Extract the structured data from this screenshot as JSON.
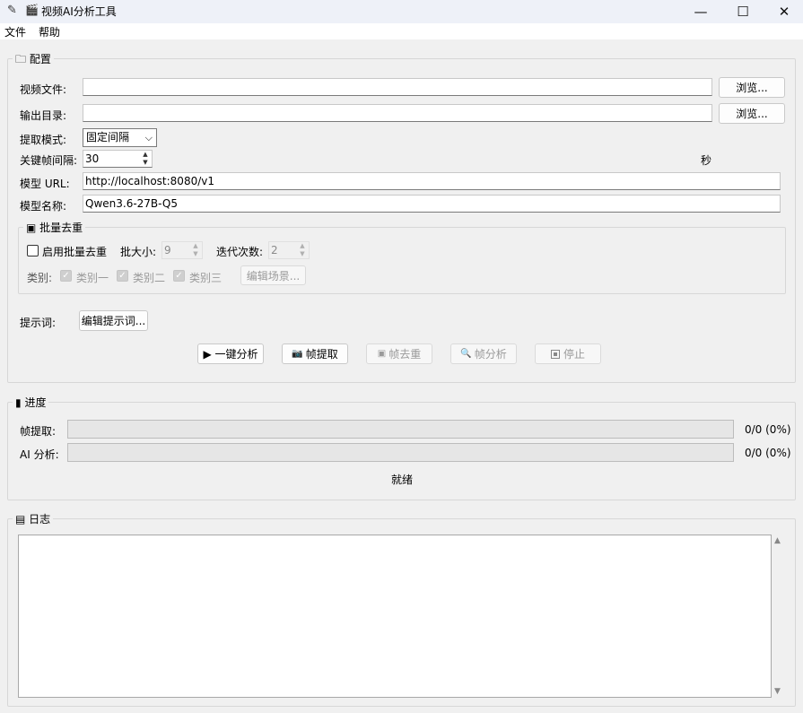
{
  "window": {
    "title": "视频AI分析工具",
    "title_icon": "clapper-icon",
    "minimize": "—",
    "maximize": "☐",
    "close": "✕"
  },
  "menu": {
    "file": "文件",
    "help": "帮助"
  },
  "config": {
    "title": "配置",
    "video_label": "视频文件:",
    "video_value": "",
    "output_label": "输出目录:",
    "output_value": "",
    "browse1": "浏览...",
    "browse2": "浏览...",
    "mode_label": "提取模式:",
    "mode_value": "固定间隔",
    "interval_label": "关键帧间隔:",
    "interval_value": "30",
    "interval_unit": "秒",
    "url_label": "模型 URL:",
    "url_value": "http://localhost:8080/v1",
    "name_label": "模型名称:",
    "name_value": "Qwen3.6-27B-Q5"
  },
  "batch": {
    "title": "批量去重",
    "enable_label": "启用批量去重",
    "enabled": false,
    "batch_size_label": "批大小:",
    "batch_size_value": "9",
    "iter_label": "迭代次数:",
    "iter_value": "2",
    "category_label": "类别:",
    "cat1": "类别一",
    "cat2": "类别二",
    "cat3": "类别三",
    "edit_scene": "编辑场景..."
  },
  "prompt": {
    "label": "提示词:",
    "edit_button": "编辑提示词..."
  },
  "actions": {
    "analyze": "▶ 一键分析",
    "extract": "帧提取",
    "dedup": "帧去重",
    "frame_analyze": "帧分析",
    "stop": "停止"
  },
  "progress": {
    "title": "进度",
    "extract_label": "帧提取:",
    "extract_value": 0,
    "extract_text": "0/0 (0%)",
    "ai_label": "AI 分析:",
    "ai_value": 0,
    "ai_text": "0/0 (0%)",
    "status": "就绪"
  },
  "log": {
    "title": "日志",
    "content": ""
  }
}
